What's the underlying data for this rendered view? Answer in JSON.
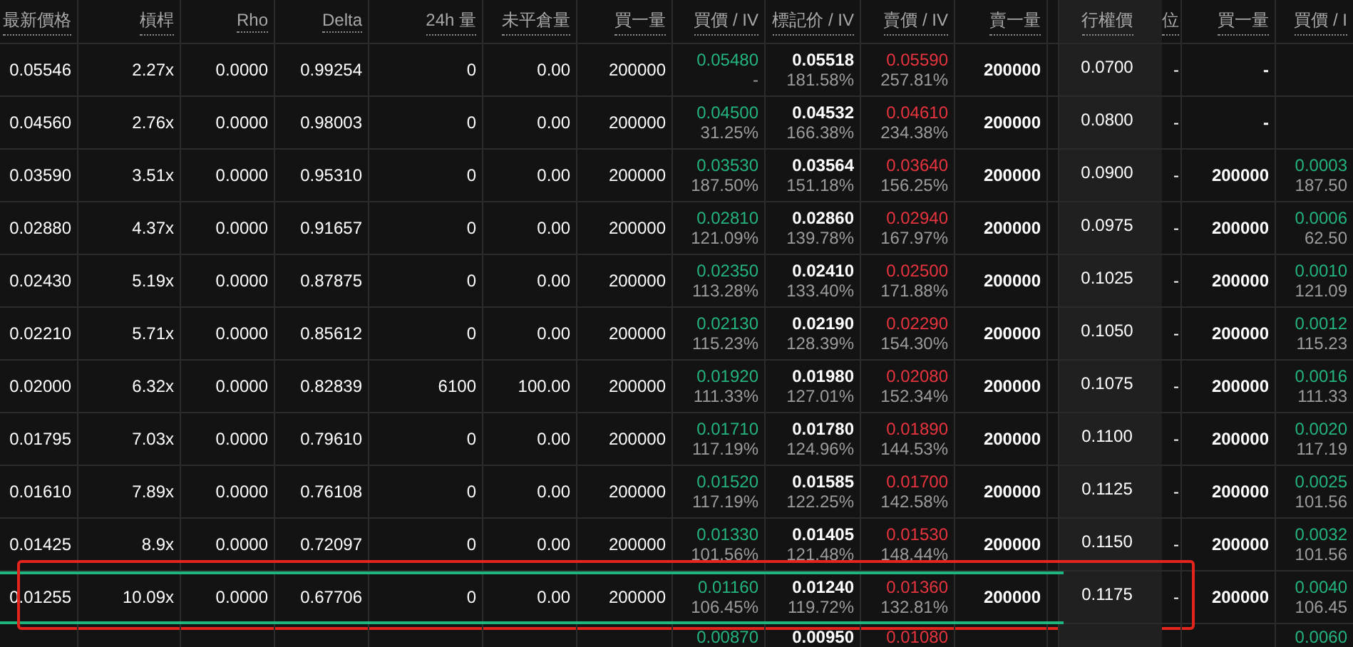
{
  "columns": [
    "最新價格",
    "槓桿",
    "Rho",
    "Delta",
    "24h 量",
    "未平倉量",
    "買一量",
    "買價 / IV",
    "標記价 / IV",
    "賣價 / IV",
    "賣一量",
    "",
    "行權價",
    "位",
    "買一量",
    "買價 / I"
  ],
  "rows": [
    {
      "kind": "full",
      "selected": false,
      "annotated": false,
      "last": "0.05546",
      "leverage": "2.27x",
      "rho": "0.0000",
      "delta": "0.99254",
      "volume": "0",
      "open_interest": "0.00",
      "bid_size": "200000",
      "bid": {
        "price": "0.05480",
        "iv": "-"
      },
      "mark": {
        "price": "0.05518",
        "iv": "181.58%"
      },
      "ask": {
        "price": "0.05590",
        "iv": "257.81%"
      },
      "ask_size": "200000",
      "strike": "0.0700",
      "column_14": "-",
      "put_bid_size": "-"
    },
    {
      "kind": "full",
      "selected": false,
      "annotated": false,
      "last": "0.04560",
      "leverage": "2.76x",
      "rho": "0.0000",
      "delta": "0.98003",
      "volume": "0",
      "open_interest": "0.00",
      "bid_size": "200000",
      "bid": {
        "price": "0.04500",
        "iv": "31.25%"
      },
      "mark": {
        "price": "0.04532",
        "iv": "166.38%"
      },
      "ask": {
        "price": "0.04610",
        "iv": "234.38%"
      },
      "ask_size": "200000",
      "strike": "0.0800",
      "column_14": "-",
      "put_bid_size": "-"
    },
    {
      "kind": "full",
      "selected": false,
      "annotated": false,
      "last": "0.03590",
      "leverage": "3.51x",
      "rho": "0.0000",
      "delta": "0.95310",
      "volume": "0",
      "open_interest": "0.00",
      "bid_size": "200000",
      "bid": {
        "price": "0.03530",
        "iv": "187.50%"
      },
      "mark": {
        "price": "0.03564",
        "iv": "151.18%"
      },
      "ask": {
        "price": "0.03640",
        "iv": "156.25%"
      },
      "ask_size": "200000",
      "strike": "0.0900",
      "column_14": "-",
      "put_bid_size": "200000",
      "put_bid": {
        "price": "0.0003",
        "iv": "187.50"
      }
    },
    {
      "kind": "full",
      "selected": false,
      "annotated": false,
      "last": "0.02880",
      "leverage": "4.37x",
      "rho": "0.0000",
      "delta": "0.91657",
      "volume": "0",
      "open_interest": "0.00",
      "bid_size": "200000",
      "bid": {
        "price": "0.02810",
        "iv": "121.09%"
      },
      "mark": {
        "price": "0.02860",
        "iv": "139.78%"
      },
      "ask": {
        "price": "0.02940",
        "iv": "167.97%"
      },
      "ask_size": "200000",
      "strike": "0.0975",
      "column_14": "-",
      "put_bid_size": "200000",
      "put_bid": {
        "price": "0.0006",
        "iv": "62.50"
      }
    },
    {
      "kind": "full",
      "selected": false,
      "annotated": false,
      "last": "0.02430",
      "leverage": "5.19x",
      "rho": "0.0000",
      "delta": "0.87875",
      "volume": "0",
      "open_interest": "0.00",
      "bid_size": "200000",
      "bid": {
        "price": "0.02350",
        "iv": "113.28%"
      },
      "mark": {
        "price": "0.02410",
        "iv": "133.40%"
      },
      "ask": {
        "price": "0.02500",
        "iv": "171.88%"
      },
      "ask_size": "200000",
      "strike": "0.1025",
      "column_14": "-",
      "put_bid_size": "200000",
      "put_bid": {
        "price": "0.0010",
        "iv": "121.09"
      }
    },
    {
      "kind": "full",
      "selected": false,
      "annotated": false,
      "last": "0.02210",
      "leverage": "5.71x",
      "rho": "0.0000",
      "delta": "0.85612",
      "volume": "0",
      "open_interest": "0.00",
      "bid_size": "200000",
      "bid": {
        "price": "0.02130",
        "iv": "115.23%"
      },
      "mark": {
        "price": "0.02190",
        "iv": "128.39%"
      },
      "ask": {
        "price": "0.02290",
        "iv": "154.30%"
      },
      "ask_size": "200000",
      "strike": "0.1050",
      "column_14": "-",
      "put_bid_size": "200000",
      "put_bid": {
        "price": "0.0012",
        "iv": "115.23"
      }
    },
    {
      "kind": "full",
      "selected": false,
      "annotated": false,
      "last": "0.02000",
      "leverage": "6.32x",
      "rho": "0.0000",
      "delta": "0.82839",
      "volume": "6100",
      "open_interest": "100.00",
      "bid_size": "200000",
      "bid": {
        "price": "0.01920",
        "iv": "111.33%"
      },
      "mark": {
        "price": "0.01980",
        "iv": "127.01%"
      },
      "ask": {
        "price": "0.02080",
        "iv": "152.34%"
      },
      "ask_size": "200000",
      "strike": "0.1075",
      "column_14": "-",
      "put_bid_size": "200000",
      "put_bid": {
        "price": "0.0016",
        "iv": "111.33"
      }
    },
    {
      "kind": "full",
      "selected": false,
      "annotated": false,
      "last": "0.01795",
      "leverage": "7.03x",
      "rho": "0.0000",
      "delta": "0.79610",
      "volume": "0",
      "open_interest": "0.00",
      "bid_size": "200000",
      "bid": {
        "price": "0.01710",
        "iv": "117.19%"
      },
      "mark": {
        "price": "0.01780",
        "iv": "124.96%"
      },
      "ask": {
        "price": "0.01890",
        "iv": "144.53%"
      },
      "ask_size": "200000",
      "strike": "0.1100",
      "column_14": "-",
      "put_bid_size": "200000",
      "put_bid": {
        "price": "0.0020",
        "iv": "117.19"
      }
    },
    {
      "kind": "full",
      "selected": false,
      "annotated": false,
      "last": "0.01610",
      "leverage": "7.89x",
      "rho": "0.0000",
      "delta": "0.76108",
      "volume": "0",
      "open_interest": "0.00",
      "bid_size": "200000",
      "bid": {
        "price": "0.01520",
        "iv": "117.19%"
      },
      "mark": {
        "price": "0.01585",
        "iv": "122.25%"
      },
      "ask": {
        "price": "0.01700",
        "iv": "142.58%"
      },
      "ask_size": "200000",
      "strike": "0.1125",
      "column_14": "-",
      "put_bid_size": "200000",
      "put_bid": {
        "price": "0.0025",
        "iv": "101.56"
      }
    },
    {
      "kind": "full",
      "selected": false,
      "annotated": false,
      "last": "0.01425",
      "leverage": "8.9x",
      "rho": "0.0000",
      "delta": "0.72097",
      "volume": "0",
      "open_interest": "0.00",
      "bid_size": "200000",
      "bid": {
        "price": "0.01330",
        "iv": "101.56%"
      },
      "mark": {
        "price": "0.01405",
        "iv": "121.48%"
      },
      "ask": {
        "price": "0.01530",
        "iv": "148.44%"
      },
      "ask_size": "200000",
      "strike": "0.1150",
      "column_14": "-",
      "put_bid_size": "200000",
      "put_bid": {
        "price": "0.0032",
        "iv": "101.56"
      }
    },
    {
      "kind": "full",
      "selected": true,
      "annotated": true,
      "last": "0.01255",
      "leverage": "10.09x",
      "rho": "0.0000",
      "delta": "0.67706",
      "volume": "0",
      "open_interest": "0.00",
      "bid_size": "200000",
      "bid": {
        "price": "0.01160",
        "iv": "106.45%"
      },
      "mark": {
        "price": "0.01240",
        "iv": "119.72%"
      },
      "ask": {
        "price": "0.01360",
        "iv": "132.81%"
      },
      "ask_size": "200000",
      "strike": "0.1175",
      "column_14": "-",
      "put_bid_size": "200000",
      "put_bid": {
        "price": "0.0040",
        "iv": "106.45"
      }
    },
    {
      "kind": "partial",
      "selected": false,
      "annotated": false,
      "bid": {
        "price": "0.00870"
      },
      "mark": {
        "price": "0.00950"
      },
      "ask": {
        "price": "0.01080"
      },
      "put_bid": {
        "price": "0.0060"
      }
    }
  ]
}
